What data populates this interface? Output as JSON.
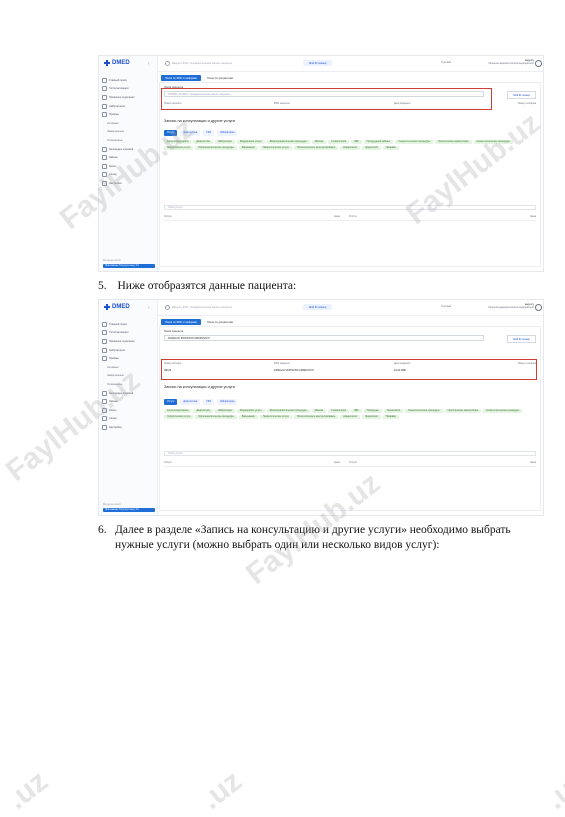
{
  "watermark": "FaylHub.uz",
  "watermarks": [
    "FaylHub.uz",
    "FaylHub.uz",
    "FaylHub.uz",
    "FaylHub.uz",
    ".uz",
    ".uz",
    ".uz"
  ],
  "app": {
    "logo": "DMED",
    "search_placeholder": "Введите ФИО, предварительная запись пациента",
    "mid_button": "Мой ID сканер",
    "language": "Русский",
    "user_name": "aagency",
    "user_sub": "Лицензия администратора медицинского",
    "side_footer_name": "Медицинский",
    "side_footer_button": "Приложение Госуслуги мед. 2.0"
  },
  "screen1": {
    "nav": [
      {
        "label": "Главный поиск",
        "sub": false
      },
      {
        "label": "Госпитализация",
        "sub": false
      },
      {
        "label": "Приемное отделение",
        "sub": false
      },
      {
        "label": "Амбулатория",
        "sub": false
      },
      {
        "label": "Приемы",
        "sub": false
      },
      {
        "label": "Активные",
        "sub": true
      },
      {
        "label": "Завершенные",
        "sub": true
      },
      {
        "label": "Отмененные",
        "sub": true
      },
      {
        "label": "Календарь приемов",
        "sub": false
      },
      {
        "label": "Заказы",
        "sub": false
      },
      {
        "label": "Кассы",
        "sub": false
      },
      {
        "label": "Склад",
        "sub": false
      },
      {
        "label": "Настройки",
        "sub": false
      }
    ],
    "tabs": [
      "Поиск по ФИО и шифрами",
      "Поиск по документам"
    ],
    "patient_label": "Поиск пациента",
    "patient_placeholder": "ПИНФЛ или ФИО / предварительная запись пациента",
    "find_button": "Мой ID сканер",
    "headers": [
      "Номер паспорта",
      "ФИО пациента",
      "Дата рождения",
      "Номер телефона"
    ],
    "section_title": "Запись на консультации и другие услуги",
    "service_tabs": [
      "Услуги",
      "Диагностика",
      "УЗИ",
      "Лаборатория"
    ],
    "chips": [
      "Консультация врача",
      "Диагностика",
      "Лаборатория",
      "Медицинские услуги",
      "Физиотерапевтические процедуры",
      "Массаж",
      "Стоматология",
      "ЛФК",
      "Процедурный кабинет",
      "Гинекологические процедуры",
      "Урологические манипуляции",
      "Косметологические процедуры",
      "Хирургические услуги",
      "Офтальмологические процедуры",
      "Вакцинация",
      "Неврологические услуги",
      "Психологическое консультирование",
      "Кардиология",
      "Эндоскопия",
      "Прививки"
    ],
    "filter_placeholder": "Поиск услуги",
    "table_headers": [
      "Услуга",
      "Цена",
      "Услуга",
      "Цена"
    ]
  },
  "step5": {
    "num": "5.",
    "text": "Ниже отобразятся данные пациента:"
  },
  "screen2": {
    "nav": [
      {
        "label": "Главный поиск",
        "sub": false
      },
      {
        "label": "Госпитализация",
        "sub": false
      },
      {
        "label": "Приемное отделение",
        "sub": false
      },
      {
        "label": "Амбулатория",
        "sub": false
      },
      {
        "label": "Приемы",
        "sub": false
      },
      {
        "label": "Активные",
        "sub": true
      },
      {
        "label": "Завершенные",
        "sub": true
      },
      {
        "label": "Отмененные",
        "sub": true
      },
      {
        "label": "Календарь приемов",
        "sub": false
      },
      {
        "label": "Заказы",
        "sub": false
      },
      {
        "label": "Кассы",
        "sub": false
      },
      {
        "label": "Склад",
        "sub": false
      },
      {
        "label": "Настройки",
        "sub": false
      }
    ],
    "tabs": [
      "Поиск по ФИО и шифрами",
      "Поиск по документам"
    ],
    "patient_label": "Поиск пациента",
    "patient_value": "KAMALOV ZOHIDJON UMAROVICH",
    "find_button": "Мой ID сканер",
    "headers": [
      "Номер паспорта",
      "ФИО пациента",
      "Дата рождения",
      "Номер телефона"
    ],
    "values": [
      "AB123",
      "KAMALOV ZOHIDJON UMAROVICH",
      "22.04.1990",
      ""
    ],
    "section_title": "Запись на консультации и другие услуги",
    "service_tabs": [
      "Услуги",
      "Диагностика",
      "УЗИ",
      "Лаборатория"
    ],
    "chips": [
      "Консультация врача",
      "Диагностика",
      "Лаборатория",
      "Медицинские услуги",
      "Физиотерапевтические процедуры",
      "Массаж",
      "Стоматология",
      "ЛФК",
      "Процедуры",
      "Гинекология",
      "Гинекологические процедуры",
      "Урологические манипуляции",
      "Косметологические процедуры",
      "Хирургические услуги",
      "Офтальмологические процедуры",
      "Вакцинация",
      "Неврологические услуги",
      "Психологическое консультирование",
      "Кардиология",
      "Эндоскопия",
      "Прививки"
    ],
    "filter_placeholder": "Поиск услуги",
    "table_headers": [
      "Услуга",
      "Цена",
      "Услуга",
      "Цена"
    ]
  },
  "step6": {
    "num": "6.",
    "text": "Далее в разделе «Запись на консультацию и другие услуги» необходимо выбрать нужные услуги (можно выбрать один или несколько видов услуг):"
  }
}
